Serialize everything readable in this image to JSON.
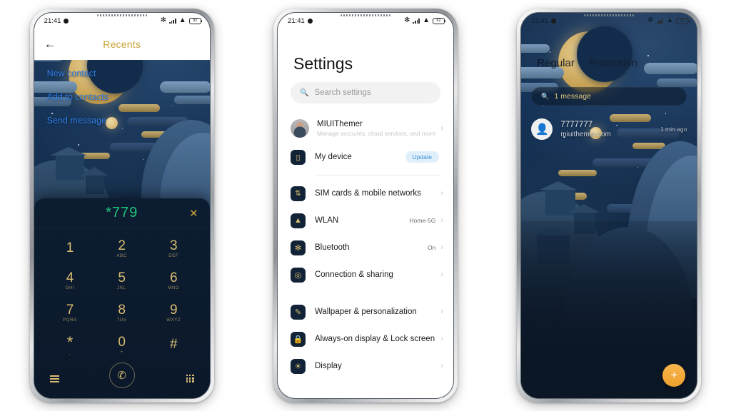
{
  "theme": {
    "accent_gold": "#d9bd71",
    "accent_green": "#1ec47a",
    "accent_blue": "#2f7fe8",
    "fab_orange": "#f0a02e",
    "panel_navy": "#0d1d31",
    "page_background": "#ffffff"
  },
  "status_bar": {
    "time": "21:41",
    "icons": [
      "bluetooth-icon",
      "signal-bars-icon",
      "wifi-icon",
      "battery-icon"
    ],
    "battery_text": "92"
  },
  "phone1": {
    "app_bar": {
      "back_icon": "back-arrow-icon",
      "title": "Recents"
    },
    "actions": [
      {
        "label": "New contact"
      },
      {
        "label": "Add to contacts"
      },
      {
        "label": "Send message"
      }
    ],
    "dialer": {
      "number": "*779",
      "clear_icon": "close-icon",
      "keys": [
        {
          "digit": "1",
          "sub": ""
        },
        {
          "digit": "2",
          "sub": "ABC"
        },
        {
          "digit": "3",
          "sub": "DEF"
        },
        {
          "digit": "4",
          "sub": "GHI"
        },
        {
          "digit": "5",
          "sub": "JKL"
        },
        {
          "digit": "6",
          "sub": "MNO"
        },
        {
          "digit": "7",
          "sub": "PQRS"
        },
        {
          "digit": "8",
          "sub": "TUV"
        },
        {
          "digit": "9",
          "sub": "WXYZ"
        },
        {
          "digit": "*",
          "sub": ","
        },
        {
          "digit": "0",
          "sub": "+"
        },
        {
          "digit": "#",
          "sub": ""
        }
      ],
      "call_icon": "phone-call-icon",
      "menu_icon": "hamburger-menu-icon",
      "keypad_icon": "dialpad-grid-icon"
    }
  },
  "phone2": {
    "title": "Settings",
    "search": {
      "placeholder": "Search settings",
      "icon": "search-icon"
    },
    "account": {
      "name": "MIUIThemer",
      "subtitle": "Manage accounts, cloud services, and more",
      "avatar": "user-avatar"
    },
    "items": [
      {
        "label": "My device",
        "value": "",
        "badge": "Update",
        "icon": "device-icon"
      },
      {
        "label": "SIM cards & mobile networks",
        "value": "",
        "icon": "sim-card-icon"
      },
      {
        "label": "WLAN",
        "value": "Home-5G",
        "icon": "wifi-icon"
      },
      {
        "label": "Bluetooth",
        "value": "On",
        "icon": "bluetooth-icon"
      },
      {
        "label": "Connection & sharing",
        "value": "",
        "icon": "connection-sharing-icon"
      },
      {
        "label": "Wallpaper & personalization",
        "value": "",
        "icon": "wallpaper-brush-icon"
      },
      {
        "label": "Always-on display & Lock screen",
        "value": "",
        "icon": "lock-icon"
      },
      {
        "label": "Display",
        "value": "",
        "icon": "brightness-icon"
      }
    ]
  },
  "phone3": {
    "tabs": [
      {
        "label": "Regular",
        "active": true
      },
      {
        "label": "Promotion",
        "active": false
      }
    ],
    "search": {
      "text": "1 message",
      "icon": "search-icon"
    },
    "conversation": {
      "name": "7777777",
      "snippet": "miuithemer.com",
      "time": "1 min ago",
      "avatar": "contact-avatar-icon"
    },
    "fab": {
      "icon": "plus-icon",
      "label": "+"
    }
  }
}
